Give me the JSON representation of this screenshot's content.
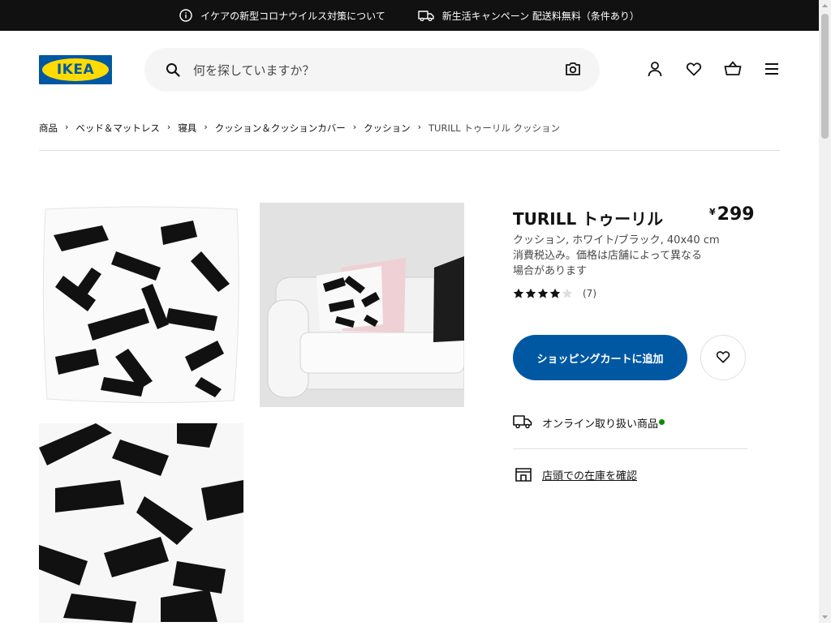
{
  "topbar": {
    "covid_notice": "イケアの新型コロナウイルス対策について",
    "campaign": "新生活キャンペーン 配送料無料（条件あり）"
  },
  "header": {
    "logo_text": "IKEA",
    "search_placeholder": "何を探していますか？"
  },
  "breadcrumb": [
    "商品",
    "ベッド＆マットレス",
    "寝具",
    "クッション＆クッションカバー",
    "クッション",
    "TURILL トゥーリル クッション"
  ],
  "product": {
    "name": "TURILL トゥーリル",
    "currency": "¥",
    "price": "299",
    "description": "クッション, ホワイト/ブラック, 40x40 cm",
    "tax_note": "消費税込み。価格は店舗によって異なる場合があります",
    "rating_value": 4,
    "rating_max": 5,
    "review_count": "(7)",
    "add_to_cart_label": "ショッピングカートに追加",
    "online_availability": "オンライン取り扱い商品",
    "store_stock_link": "店頭での在庫を確認"
  },
  "colors": {
    "brand_blue": "#0058a3",
    "brand_yellow": "#ffdb00",
    "topbar_bg": "#111111",
    "available_green": "#0a8a00"
  },
  "icons": [
    "info-icon",
    "delivery-truck-icon",
    "search-icon",
    "camera-icon",
    "user-icon",
    "heart-icon",
    "cart-icon",
    "menu-icon",
    "star-icon",
    "store-icon"
  ]
}
